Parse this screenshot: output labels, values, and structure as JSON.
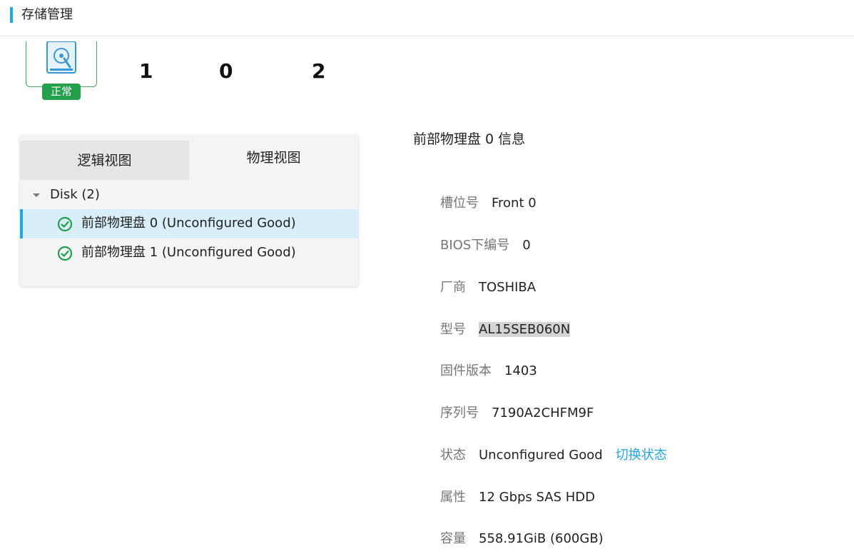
{
  "header": {
    "title": "存储管理"
  },
  "status": {
    "badge": "正常",
    "counts": [
      "1",
      "0",
      "2"
    ]
  },
  "tabs": {
    "logical": "逻辑视图",
    "physical": "物理视图"
  },
  "tree": {
    "group_label": "Disk (2)",
    "items": [
      {
        "label": "前部物理盘 0 (Unconfigured Good)",
        "selected": true
      },
      {
        "label": "前部物理盘 1 (Unconfigured Good)",
        "selected": false
      }
    ]
  },
  "info": {
    "title": "前部物理盘 0 信息",
    "fields": [
      {
        "key": "槽位号",
        "value": "Front 0"
      },
      {
        "key": "BIOS下编号",
        "value": "0"
      },
      {
        "key": "厂商",
        "value": "TOSHIBA"
      },
      {
        "key": "型号",
        "value": "AL15SEB060N"
      },
      {
        "key": "固件版本",
        "value": "1403"
      },
      {
        "key": "序列号",
        "value": "7190A2CHFM9F"
      },
      {
        "key": "状态",
        "value": "Unconfigured Good",
        "action": "切换状态"
      },
      {
        "key": "属性",
        "value": "12 Gbps SAS HDD"
      },
      {
        "key": "容量",
        "value": "558.91GiB (600GB)"
      }
    ]
  },
  "colors": {
    "accent": "#1fa7e6",
    "ok_green": "#22a04b",
    "selected_row": "#d8eef8"
  }
}
